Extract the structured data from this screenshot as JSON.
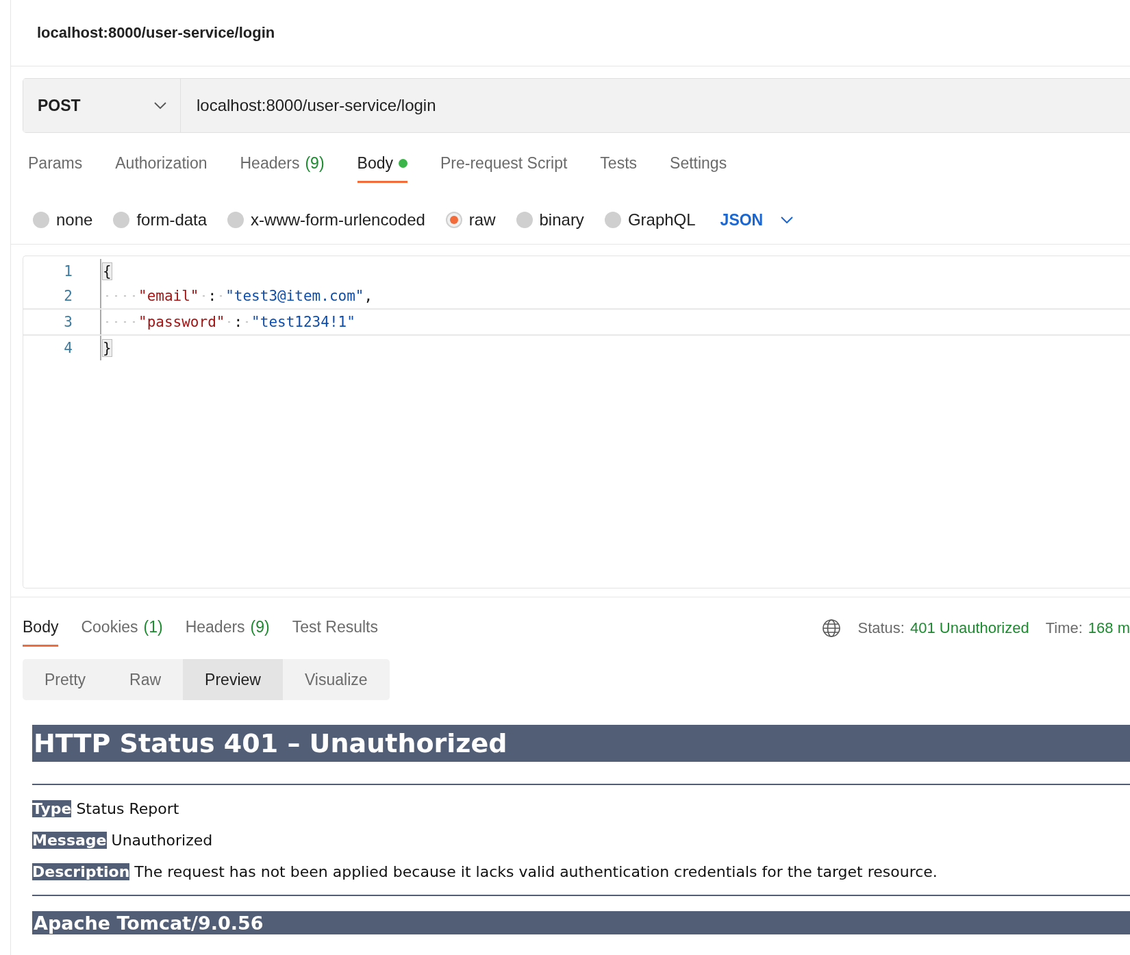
{
  "tab_title": "localhost:8000/user-service/login",
  "request": {
    "method": "POST",
    "url": "localhost:8000/user-service/login"
  },
  "request_tabs": [
    {
      "label": "Params",
      "selected": false,
      "modified": false
    },
    {
      "label": "Authorization",
      "selected": false,
      "modified": false
    },
    {
      "label": "Headers",
      "count": "(9)",
      "selected": false,
      "modified": false
    },
    {
      "label": "Body",
      "selected": true,
      "modified": true
    },
    {
      "label": "Pre-request Script",
      "selected": false,
      "modified": false
    },
    {
      "label": "Tests",
      "selected": false,
      "modified": false
    },
    {
      "label": "Settings",
      "selected": false,
      "modified": false
    }
  ],
  "body_types": [
    {
      "label": "none",
      "selected": false
    },
    {
      "label": "form-data",
      "selected": false
    },
    {
      "label": "x-www-form-urlencoded",
      "selected": false
    },
    {
      "label": "raw",
      "selected": true
    },
    {
      "label": "binary",
      "selected": false
    },
    {
      "label": "GraphQL",
      "selected": false
    }
  ],
  "body_format": "JSON",
  "editor": {
    "lines": [
      {
        "number": "1",
        "active": false,
        "tokens": [
          {
            "kind": "brace",
            "text": "{",
            "matched": true
          }
        ]
      },
      {
        "number": "2",
        "active": false,
        "tokens": [
          {
            "kind": "indent"
          },
          {
            "kind": "key",
            "text": "\"email\""
          },
          {
            "kind": "space"
          },
          {
            "kind": "punct",
            "text": ":"
          },
          {
            "kind": "space"
          },
          {
            "kind": "string",
            "text": "\"test3@item.com\""
          },
          {
            "kind": "punct",
            "text": ","
          }
        ]
      },
      {
        "number": "3",
        "active": true,
        "tokens": [
          {
            "kind": "indent"
          },
          {
            "kind": "key",
            "text": "\"password\""
          },
          {
            "kind": "space"
          },
          {
            "kind": "punct",
            "text": ":"
          },
          {
            "kind": "space"
          },
          {
            "kind": "string",
            "text": "\"test1234!1\""
          }
        ]
      },
      {
        "number": "4",
        "active": false,
        "tokens": [
          {
            "kind": "brace",
            "text": "}",
            "matched": true
          }
        ]
      }
    ]
  },
  "response_tabs": [
    {
      "label": "Body",
      "selected": true
    },
    {
      "label": "Cookies",
      "count": "(1)",
      "selected": false
    },
    {
      "label": "Headers",
      "count": "(9)",
      "selected": false
    },
    {
      "label": "Test Results",
      "selected": false
    }
  ],
  "status": {
    "label": "Status:",
    "value": "401 Unauthorized"
  },
  "time": {
    "label": "Time:",
    "value": "168 m"
  },
  "view_modes": [
    {
      "label": "Pretty",
      "selected": false
    },
    {
      "label": "Raw",
      "selected": false
    },
    {
      "label": "Preview",
      "selected": true
    },
    {
      "label": "Visualize",
      "selected": false
    }
  ],
  "preview": {
    "heading": "HTTP Status 401 – Unauthorized",
    "fields": [
      {
        "label": "Type",
        "value": "Status Report"
      },
      {
        "label": "Message",
        "value": "Unauthorized"
      },
      {
        "label": "Description",
        "value": "The request has not been applied because it lacks valid authentication credentials for the target resource."
      }
    ],
    "footer": "Apache Tomcat/9.0.56"
  }
}
